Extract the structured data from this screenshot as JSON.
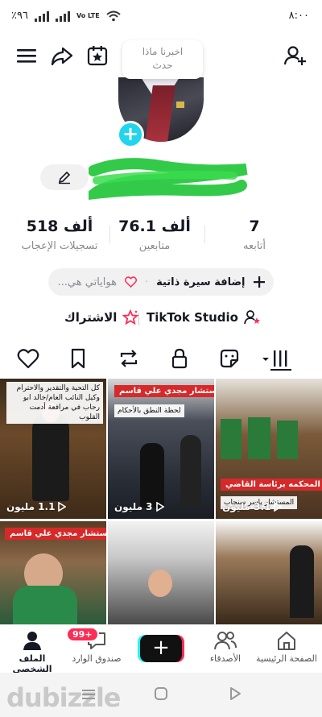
{
  "status_bar": {
    "time": "٨:٠٠",
    "battery": "٪٩٦",
    "network": "Vo LTE"
  },
  "note_bubble": {
    "line1": "اخبرنا ماذا",
    "line2": "حدث"
  },
  "stats": {
    "following": {
      "value": "7",
      "label": "أتابعه"
    },
    "followers": {
      "value": "76.1 ألف",
      "label": "متابعين"
    },
    "likes": {
      "value": "518 ألف",
      "label": "تسجيلات الإعجاب"
    }
  },
  "bio": {
    "add_bio": "إضافة سيرة ذاتية",
    "hobbies": "هواياتي هي..."
  },
  "links": {
    "studio": "TikTok Studio",
    "subscribe": "الاشتراك"
  },
  "videos": [
    {
      "views": "1.1 مليون",
      "caption": "كل التحية والتقدير والاحترام وكيل النائب العام/خالد ابو رحاب في مرافعة أدمت القلوب"
    },
    {
      "views": "3 مليون",
      "caption": "المستشار مجدي علي قاسم",
      "subcaption": "لحظة النطق بالأحكام"
    },
    {
      "views": "3.1 مليون",
      "caption": "المحكمه برئاسة القاضي",
      "subcaption": "المستشار ياسر سنجاب"
    },
    {
      "views": "",
      "caption": "المستشار مجدي علي قاسم"
    },
    {
      "views": "",
      "caption": ""
    },
    {
      "views": "",
      "caption": ""
    }
  ],
  "bottom_nav": {
    "home": "الصفحة الرئيسية",
    "friends": "الأصدقاء",
    "inbox": "صندوق الوارد",
    "inbox_badge": "99+",
    "profile": "الملف الشخصي"
  },
  "watermark": "dubizzle",
  "colors": {
    "accent_cyan": "#20d5ec",
    "accent_red": "#fe2c55",
    "scribble_green": "#22c63a"
  }
}
